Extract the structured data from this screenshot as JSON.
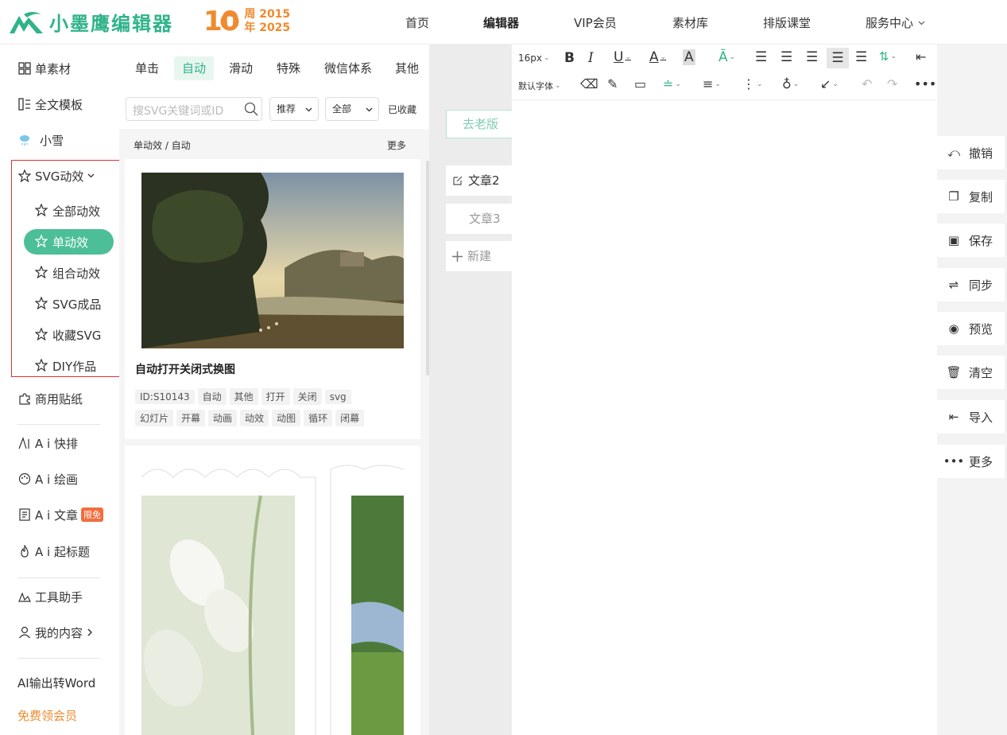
{
  "header": {
    "logo_text": "小墨鹰编辑器",
    "anniversary": {
      "number": "10",
      "line1": "周 2015",
      "line2": "年 2025"
    },
    "nav": [
      "首页",
      "编辑器",
      "VIP会员",
      "素材库",
      "排版课堂",
      "服务中心"
    ],
    "nav_active": "编辑器"
  },
  "sidebar": {
    "items_top": [
      "单素材",
      "全文模板",
      "小雪"
    ],
    "svg_group": "SVG动效",
    "svg_sub": [
      "全部动效",
      "单动效",
      "组合动效",
      "SVG成品",
      "收藏SVG",
      "DIY作品"
    ],
    "svg_active": "单动效",
    "sticker": "商用贴纸",
    "ai_items": [
      "A i 快排",
      "A i 绘画",
      "A i 文章",
      "A i 起标题"
    ],
    "ai_badge": "限免",
    "tools": [
      "工具助手",
      "我的内容"
    ],
    "word": "AI输出转Word",
    "free_vip": "免费领会员"
  },
  "materials": {
    "tabs": [
      "单击",
      "自动",
      "滑动",
      "特殊",
      "微信体系",
      "其他"
    ],
    "active_tab": "自动",
    "search_placeholder": "搜SVG关键词或ID",
    "sort": "推荐",
    "scope": "全部",
    "favorites": "已收藏",
    "breadcrumb": "单动效 / 自动",
    "more": "更多",
    "card": {
      "title": "自动打开关闭式换图",
      "tags": [
        "ID:S10143",
        "自动",
        "其他",
        "打开",
        "关闭",
        "svg",
        "幻灯片",
        "开幕",
        "动画",
        "动效",
        "动图",
        "循环",
        "闭幕"
      ]
    }
  },
  "articles": {
    "old_version": "去老版",
    "items": [
      "文章2",
      "文章3"
    ],
    "new": "新建"
  },
  "toolbar": {
    "font_size": "16px",
    "font_family": "默认字体"
  },
  "actions": [
    "撤销",
    "复制",
    "保存",
    "同步",
    "预览",
    "清空",
    "导入",
    "更多"
  ],
  "colors": {
    "brand": "#2fb38a",
    "active_pill": "#4dbf98",
    "anniversary": "#f08a2e",
    "highlight_box": "#e03131",
    "badge": "#f26d3d"
  }
}
